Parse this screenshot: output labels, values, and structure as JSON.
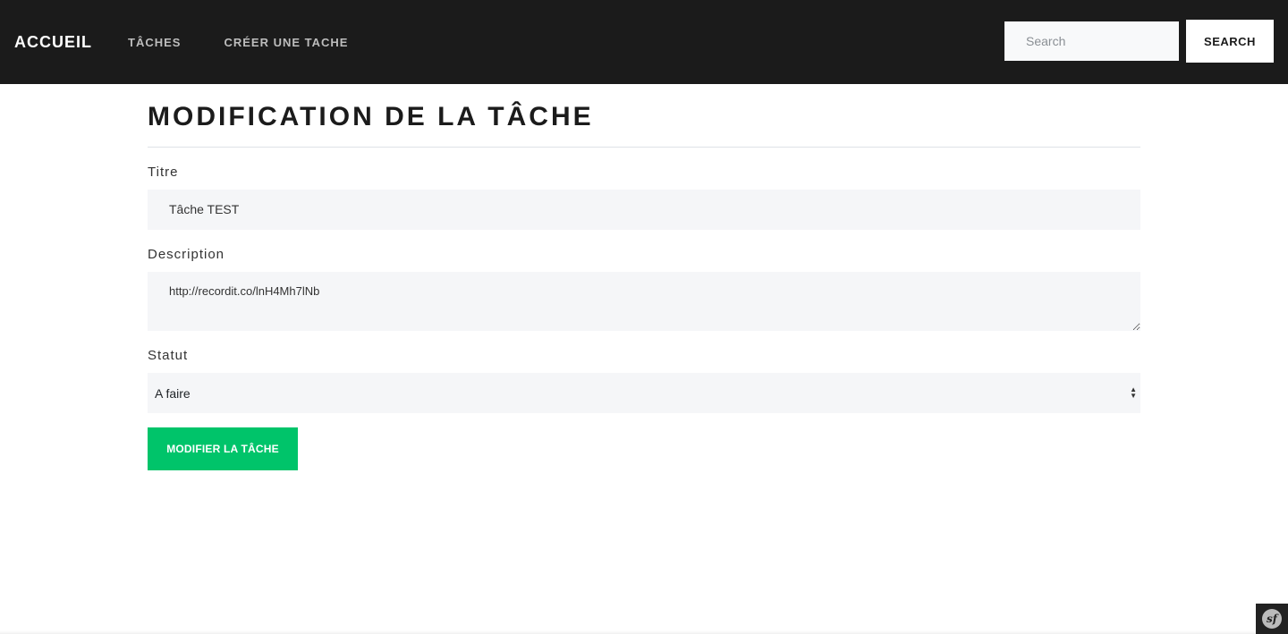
{
  "nav": {
    "brand": "ACCUEIL",
    "links": [
      "TÂCHES",
      "CRÉER UNE TACHE"
    ],
    "search_placeholder": "Search",
    "search_button": "SEARCH"
  },
  "form": {
    "title": "MODIFICATION DE LA TÂCHE",
    "titre_label": "Titre",
    "titre_value": "Tâche TEST",
    "description_label": "Description",
    "description_value": "http://recordit.co/lnH4Mh7lNb",
    "statut_label": "Statut",
    "statut_selected": "A faire",
    "submit_label": "MODIFIER LA TÂCHE"
  },
  "debug_toolbar": {
    "logo_text": "sf"
  },
  "colors": {
    "navbar_bg": "#1b1b1b",
    "accent_green": "#00c46a",
    "input_bg": "#f5f6f8"
  }
}
